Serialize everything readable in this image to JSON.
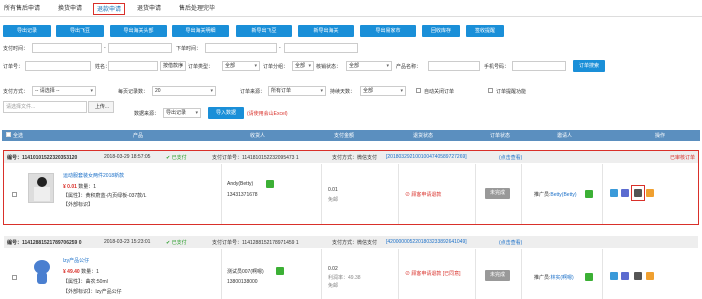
{
  "tabs": [
    {
      "label": "所有售后申请"
    },
    {
      "label": "换货申请"
    },
    {
      "label": "退款申请"
    },
    {
      "label": "退货申请"
    },
    {
      "label": "售后处理完毕"
    }
  ],
  "toolbar": {
    "buttons": [
      "导出记录",
      "导出飞豆",
      "导出海关头部",
      "导出海关明细",
      "新导出飞豆",
      "新导出海关",
      "导出易家市",
      "回收库存",
      "签收提醒"
    ]
  },
  "filters": {
    "pay_time_label": "支付时间：",
    "order_time_label": "下单时间：",
    "range_sep": "-",
    "order_no_label": "订单号：",
    "name_label": "姓名：",
    "sort_value": "按借款序",
    "order_type_label": "订单类型：",
    "order_type_value": "全部",
    "order_group_label": "订单分组：",
    "order_group_value": "全部",
    "verify_label": "核销状态：",
    "verify_value": "全部",
    "product_label": "产品名称：",
    "phone_label": "手机号码：",
    "search_btn": "订单搜索",
    "pay_method_label": "支付方式：",
    "pay_method_value": "-- 请选择 --",
    "page_size_label": "每页记录数：",
    "page_size_value": "20",
    "order_source_label": "订单来源：",
    "order_source_value": "所有订单",
    "duration_label": "持续天数：",
    "duration_value": "全部",
    "auto_refund_label": "自动关闭订单",
    "remind_label": "订单提醒功能",
    "file_placeholder": "请选择文件...",
    "upload_btn": "上传...",
    "data_source_label": "数据来源：",
    "data_source_value": "导出记录",
    "import_btn": "导入数据",
    "import_note": "(请使用会山Excel)"
  },
  "table_header": {
    "select_all": "全选",
    "product": "产品",
    "recipient": "收货人",
    "pay_amount": "支付金额",
    "refund_status": "退货状态",
    "order_status": "订单状态",
    "promoter": "邀请人",
    "actions": "操作"
  },
  "orders": [
    {
      "order_no": "编号：11410101522320353120",
      "time": "2018-03-29 18:57:05",
      "pay_status": "已支付",
      "pay_no": "支付订单号：1141810152232095473 1",
      "pay_method": "支付方式：微信支付",
      "trans_no": "[2018032921001004740589727269]",
      "trans_link": "(点击查看)",
      "side_status": "已审核订单",
      "product_title": "运动服套装女两件2018新款",
      "price": "¥ 0.01",
      "qty": "数量：1",
      "attr": "【属性】：黄积蔚蓝-内页绿板-037款/L",
      "extra": "【外部标识】",
      "recipient": "Andy(Betty)",
      "phone": "13431371678",
      "amount": "0.01",
      "amount_sub": "免邮",
      "refund_status": "顾客申请退款",
      "order_status": "未完成",
      "promoter": "推广员:",
      "promoter_name": "Betty(Betty)"
    },
    {
      "order_no": "编号：11412881521789706259 0",
      "time": "2018-03-23 15:23:01",
      "pay_status": "已支付",
      "pay_no": "支付订单号：1141288152178971459 1",
      "pay_method": "支付方式：微信支付",
      "trans_no": "[4200000052201803233892641049]",
      "trans_link": "(点击查看)",
      "product_title": "lzy产品公仔",
      "price": "¥ 49.40",
      "qty": "数量：1",
      "attr": "【属性】：曲农:50ml",
      "extra": "【外部标识】：lzy产品公仔",
      "recipient": "测试员007(啊嗯)",
      "phone": "13800138000",
      "amount": "0.02",
      "amount_sub": "利润率：49.38",
      "amount_sub2": "免邮",
      "refund_status": "顾客申请退款 [已同意]",
      "order_status": "未完成",
      "promoter": "推广员:",
      "promoter_name": "林实(啊嗯)"
    }
  ],
  "colors": {
    "accent": "#1a8fd8",
    "header": "#5b8fbf",
    "highlight": "#d9302a"
  }
}
